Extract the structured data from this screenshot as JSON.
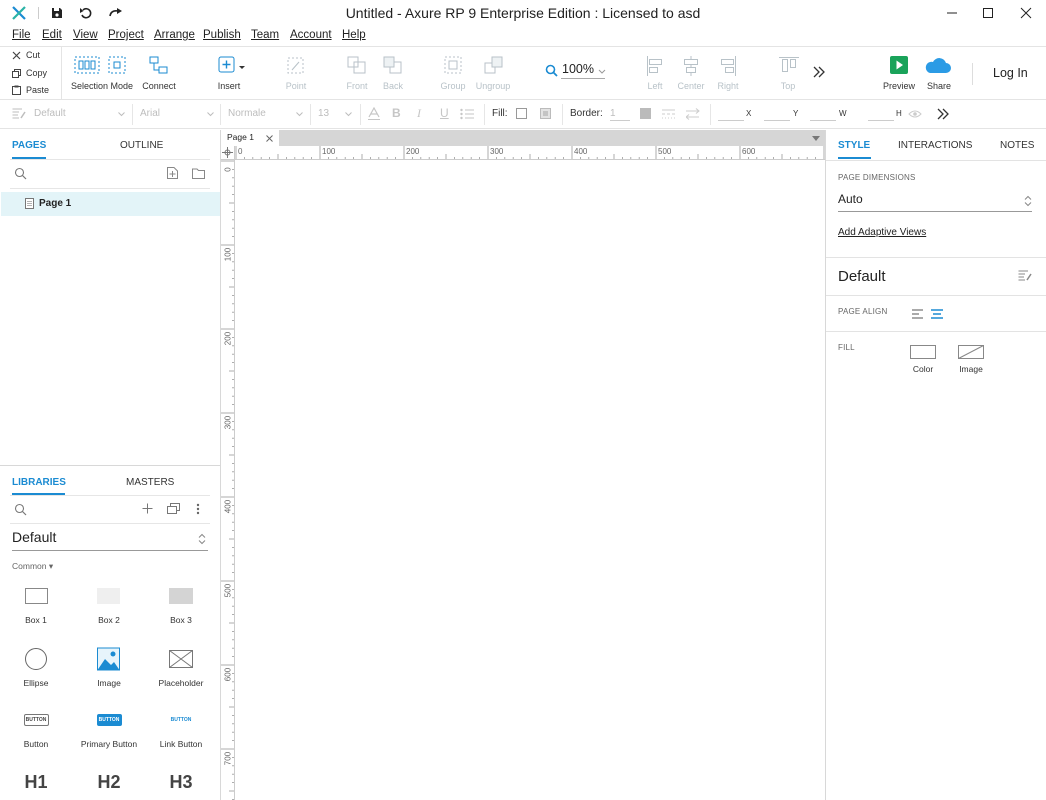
{
  "window": {
    "title": "Untitled - Axure RP 9 Enterprise Edition : Licensed to asd"
  },
  "menu": [
    "File",
    "Edit",
    "View",
    "Project",
    "Arrange",
    "Publish",
    "Team",
    "Account",
    "Help"
  ],
  "clipboard": {
    "cut": "Cut",
    "copy": "Copy",
    "paste": "Paste"
  },
  "toolbar": {
    "selection_mode": "Selection Mode",
    "connect": "Connect",
    "insert": "Insert",
    "point": "Point",
    "front": "Front",
    "back": "Back",
    "group": "Group",
    "ungroup": "Ungroup",
    "zoom": "100%",
    "left": "Left",
    "center": "Center",
    "right": "Right",
    "top": "Top",
    "preview": "Preview",
    "share": "Share",
    "login": "Log In"
  },
  "format": {
    "style": "Default",
    "font": "Arial",
    "weight": "Normale",
    "size": "13",
    "fill_label": "Fill:",
    "border_label": "Border:",
    "border_value": "1",
    "x": "X",
    "y": "Y",
    "w": "W",
    "h": "H"
  },
  "pages_panel": {
    "tabs": [
      "PAGES",
      "OUTLINE"
    ],
    "items": [
      "Page 1"
    ]
  },
  "libraries_panel": {
    "tabs": [
      "LIBRARIES",
      "MASTERS"
    ],
    "library": "Default",
    "section": "Common ▾",
    "items": [
      "Box 1",
      "Box 2",
      "Box 3",
      "Ellipse",
      "Image",
      "Placeholder",
      "Button",
      "Primary Button",
      "Link Button",
      "H1",
      "H2",
      "H3"
    ],
    "button_glyph": "BUTTON"
  },
  "canvas": {
    "tab": "Page 1",
    "ruler_h": [
      "0",
      "100",
      "200",
      "300",
      "400",
      "500",
      "600"
    ],
    "ruler_v": [
      "0",
      "100",
      "200",
      "300",
      "400",
      "500",
      "600",
      "700"
    ]
  },
  "inspector": {
    "tabs": [
      "STYLE",
      "INTERACTIONS",
      "NOTES"
    ],
    "page_dimensions_label": "PAGE DIMENSIONS",
    "page_dimensions_value": "Auto",
    "add_adaptive_views": "Add Adaptive Views",
    "style_name": "Default",
    "page_align_label": "PAGE ALIGN",
    "fill_label": "FILL",
    "fill_color": "Color",
    "fill_image": "Image"
  },
  "colors": {
    "accent": "#1b8bd2",
    "preview_green": "#1aa35a",
    "share_blue": "#2b9be5",
    "selected_row": "#e3f4f8"
  }
}
